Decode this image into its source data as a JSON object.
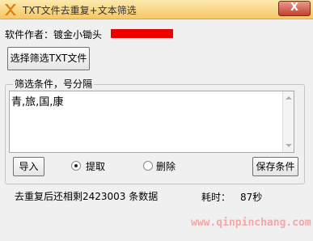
{
  "window": {
    "title": "TXT文件去重复+文本筛选",
    "close_label": "X"
  },
  "author": {
    "label": "软件作者：镀金小锄头"
  },
  "buttons": {
    "select_txt": "选择筛选TXT文件",
    "import": "导入",
    "save_conditions": "保存条件"
  },
  "filter": {
    "group_label": "筛选条件，号分隔",
    "text": "青,旅,国,康"
  },
  "options": {
    "extract_label": "提取",
    "extract_selected": true,
    "delete_label": "删除",
    "delete_selected": false
  },
  "status": {
    "result": "去重复后还相剩2423003 条数据",
    "time_label": "耗时：",
    "time_value": "87秒"
  },
  "watermark": "www.qinpinchang.com",
  "colors": {
    "title_bar": "#f6c766",
    "close_button": "#c4402b",
    "author_redaction": "#ee0000"
  }
}
